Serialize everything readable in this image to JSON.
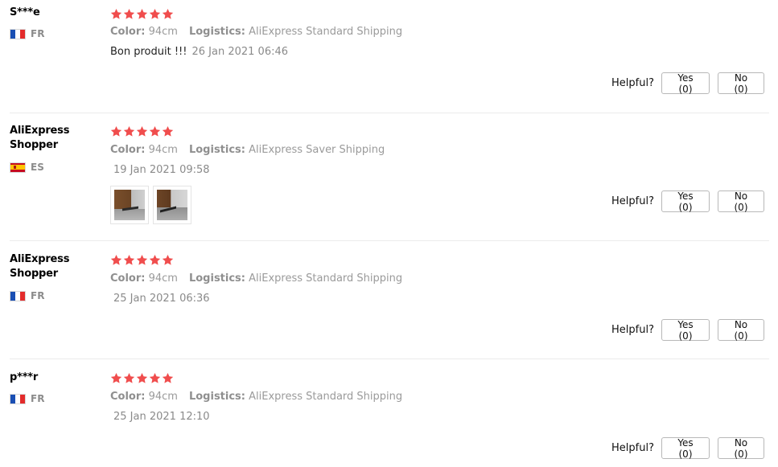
{
  "colors": {
    "star": "#f04d4d",
    "meta_text": "#9a9a9a",
    "divider": "#ebebeb"
  },
  "reviews": [
    {
      "user": "S***e",
      "country": "FR",
      "rating": 5,
      "color_label": "Color:",
      "color_value": "94cm",
      "logistics_label": "Logistics:",
      "logistics_value": "AliExpress Standard Shipping",
      "text": "Bon produit !!!",
      "date": "26 Jan 2021 06:46",
      "helpful_label": "Helpful?",
      "yes_label": "Yes (0)",
      "no_label": "No (0)"
    },
    {
      "user": "AliExpress Shopper",
      "country": "ES",
      "rating": 5,
      "color_label": "Color:",
      "color_value": "94cm",
      "logistics_label": "Logistics:",
      "logistics_value": "AliExpress Saver Shipping",
      "text": "",
      "date": "19 Jan 2021 09:58",
      "photos": [
        "review-photo-1",
        "review-photo-2"
      ],
      "helpful_label": "Helpful?",
      "yes_label": "Yes (0)",
      "no_label": "No (0)"
    },
    {
      "user": "AliExpress Shopper",
      "country": "FR",
      "rating": 5,
      "color_label": "Color:",
      "color_value": "94cm",
      "logistics_label": "Logistics:",
      "logistics_value": "AliExpress Standard Shipping",
      "text": "",
      "date": "25 Jan 2021 06:36",
      "helpful_label": "Helpful?",
      "yes_label": "Yes (0)",
      "no_label": "No (0)"
    },
    {
      "user": "p***r",
      "country": "FR",
      "rating": 5,
      "color_label": "Color:",
      "color_value": "94cm",
      "logistics_label": "Logistics:",
      "logistics_value": "AliExpress Standard Shipping",
      "text": "",
      "date": "25 Jan 2021 12:10",
      "helpful_label": "Helpful?",
      "yes_label": "Yes (0)",
      "no_label": "No (0)"
    }
  ]
}
